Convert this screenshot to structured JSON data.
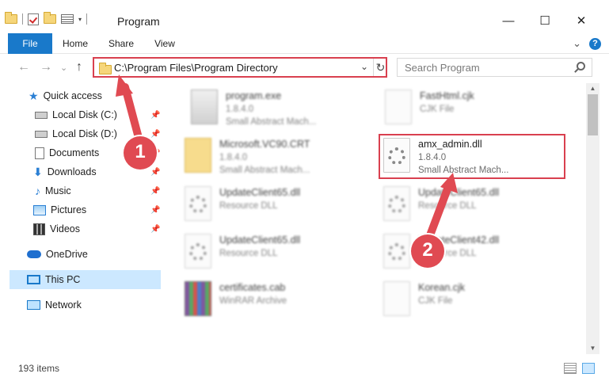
{
  "window": {
    "title": "Program",
    "minimize": "—",
    "maximize": "☐",
    "close": "✕"
  },
  "ribbon": {
    "tabs": [
      "File",
      "Home",
      "Share",
      "View"
    ],
    "expand_glyph": "⌄",
    "help": "?"
  },
  "address": {
    "path": "C:\\Program Files\\Program Directory",
    "dropdown_glyph": "⌄",
    "refresh_glyph": "↻"
  },
  "nav_buttons": {
    "back": "←",
    "forward": "→",
    "recent": "⌄",
    "up": "↑"
  },
  "search": {
    "placeholder": "Search Program"
  },
  "navpane": {
    "quick_access": "Quick access",
    "items": [
      {
        "label": "Local Disk (C:)",
        "icon": "drive-icon"
      },
      {
        "label": "Local Disk (D:)",
        "icon": "drive-icon"
      },
      {
        "label": "Documents",
        "icon": "documents-icon"
      },
      {
        "label": "Downloads",
        "icon": "downloads-icon"
      },
      {
        "label": "Music",
        "icon": "music-icon"
      },
      {
        "label": "Pictures",
        "icon": "pictures-icon"
      },
      {
        "label": "Videos",
        "icon": "videos-icon"
      }
    ],
    "onedrive": "OneDrive",
    "this_pc": "This PC",
    "network": "Network"
  },
  "files": [
    {
      "name": "program.exe",
      "d1": "1.8.4.0",
      "d2": "Small Abstract Mach...",
      "kind": "exe"
    },
    {
      "name": "FastHtml.cjk",
      "d1": "CJK File",
      "d2": "",
      "kind": "page"
    },
    {
      "name": "Microsoft.VC90.CRT",
      "d1": "1.8.4.0",
      "d2": "Small Abstract Mach...",
      "kind": "folder"
    },
    {
      "name": "amx_admin.dll",
      "d1": "1.8.4.0",
      "d2": "Small Abstract Mach...",
      "kind": "dll"
    },
    {
      "name": "UpdateClient65.dll",
      "d1": "Resource DLL",
      "d2": "",
      "kind": "dll"
    },
    {
      "name": "UpdateClient65.dll",
      "d1": "Resource DLL",
      "d2": "",
      "kind": "dll"
    },
    {
      "name": "UpdateClient65.dll",
      "d1": "Resource DLL",
      "d2": "",
      "kind": "dll"
    },
    {
      "name": "UpdateClient42.dll",
      "d1": "Resource DLL",
      "d2": "",
      "kind": "dll"
    },
    {
      "name": "certificates.cab",
      "d1": "WinRAR Archive",
      "d2": "",
      "kind": "cab"
    },
    {
      "name": "Korean.cjk",
      "d1": "CJK File",
      "d2": "",
      "kind": "page"
    }
  ],
  "status": {
    "items": "193 items"
  },
  "callouts": [
    "1",
    "2"
  ],
  "colors": {
    "accent": "#1979ca",
    "highlight": "#d9404f",
    "selection": "#cce8ff"
  }
}
